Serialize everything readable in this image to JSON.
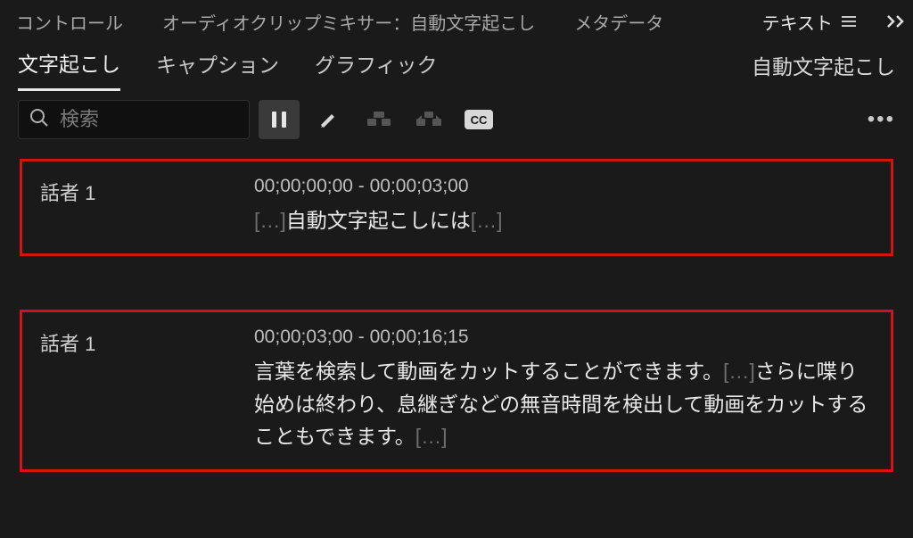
{
  "topTabs": {
    "control": "コントロール",
    "audioMixer": "オーディオクリップミキサー：自動文字起こし",
    "metadata": "メタデータ",
    "text": "テキスト"
  },
  "subTabs": {
    "transcribe": "文字起こし",
    "captions": "キャプション",
    "graphics": "グラフィック",
    "autoTranscribe": "自動文字起こし"
  },
  "search": {
    "placeholder": "検索"
  },
  "segments": [
    {
      "speaker": "話者 1",
      "time": "00;00;00;00 - 00;00;03;00",
      "pre": "[…]",
      "text": "自動文字起こしには",
      "post": "[…]"
    },
    {
      "speaker": "話者 1",
      "time": "00;00;03;00 - 00;00;16;15",
      "textA": "言葉を検索して動画をカットすることができます。",
      "mid": "[…]",
      "textB": "さらに喋り始めは終わり、息継ぎなどの無音時間を検出して動画をカットすることもできます。",
      "post": "[…]"
    }
  ],
  "cc_label": "CC"
}
